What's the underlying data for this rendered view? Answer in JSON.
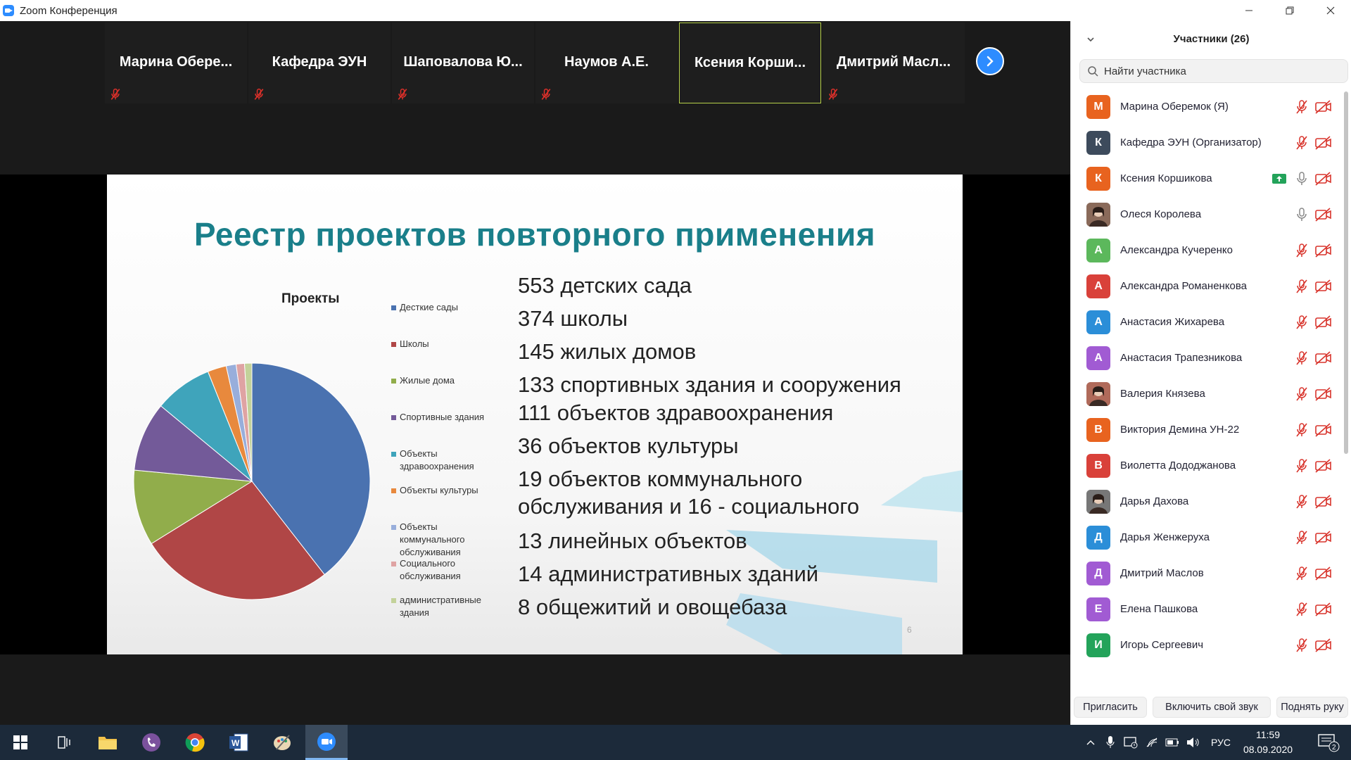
{
  "window": {
    "title": "Zoom Конференция",
    "controls": {
      "minimize": "—",
      "restore": "❐",
      "close": "✕"
    }
  },
  "gallery": {
    "tiles": [
      {
        "name": "Марина  Обере...",
        "muted": true,
        "active": false
      },
      {
        "name": "Кафедра ЭУН",
        "muted": true,
        "active": false
      },
      {
        "name": "Шаповалова  Ю...",
        "muted": true,
        "active": false
      },
      {
        "name": "Наумов А.Е.",
        "muted": true,
        "active": false
      },
      {
        "name": "Ксения  Корши...",
        "muted": false,
        "active": true
      },
      {
        "name": "Дмитрий  Масл...",
        "muted": true,
        "active": false
      }
    ],
    "next_icon": "chevron-right-icon"
  },
  "slide": {
    "title": "Реестр проектов повторного применения",
    "page_number": "6",
    "stats": [
      "553 детских сада",
      "374 школы",
      "145 жилых домов",
      "133 спортивных здания и сооружения",
      "111 объектов здравоохранения",
      "36 объектов культуры",
      "19 объектов коммунального",
      "обслуживания и 16 - социального",
      "13 линейных объектов",
      "14 административных зданий",
      "8 общежитий и овощебаза"
    ],
    "chart_data": {
      "type": "pie",
      "title": "Проекты",
      "legend_position": "right",
      "categories": [
        "Десткие сады",
        "Школы",
        "Жилые дома",
        "Спортивные здания",
        "Объекты здравоохранения",
        "Объекты культуры",
        "Объекты коммунального обслуживания",
        "Социального обслуживания",
        "административные здания"
      ],
      "values": [
        553,
        374,
        145,
        133,
        111,
        36,
        19,
        16,
        14
      ],
      "colors": [
        "#4a72b0",
        "#b04646",
        "#91ad4b",
        "#735a99",
        "#3fa4bb",
        "#e8893d",
        "#98aedb",
        "#dfa3a3",
        "#c3d29a"
      ]
    }
  },
  "panel": {
    "title": "Участники (26)",
    "search_placeholder": "Найти участника",
    "participants": [
      {
        "name": "Марина Оберемок (Я)",
        "initial": "М",
        "color": "#e8631f",
        "mic": "muted",
        "sharing": false,
        "photo": false
      },
      {
        "name": "Кафедра ЭУН (Организатор)",
        "initial": "К",
        "color": "#3d4b5c",
        "mic": "muted",
        "sharing": false,
        "photo": false
      },
      {
        "name": "Ксения Коршикова",
        "initial": "К",
        "color": "#e8631f",
        "mic": "on",
        "sharing": true,
        "photo": false
      },
      {
        "name": "Олеся Королева",
        "initial": "",
        "color": "#8a6a5a",
        "mic": "on",
        "sharing": false,
        "photo": true
      },
      {
        "name": "Александра Кучеренко",
        "initial": "А",
        "color": "#5cb85c",
        "mic": "muted",
        "sharing": false,
        "photo": false
      },
      {
        "name": "Александра Романенкова",
        "initial": "А",
        "color": "#d9413a",
        "mic": "muted",
        "sharing": false,
        "photo": false
      },
      {
        "name": "Анастасия Жихарева",
        "initial": "А",
        "color": "#2b8ed8",
        "mic": "muted",
        "sharing": false,
        "photo": false
      },
      {
        "name": "Анастасия Трапезникова",
        "initial": "А",
        "color": "#a15bd3",
        "mic": "muted",
        "sharing": false,
        "photo": false
      },
      {
        "name": "Валерия Князева",
        "initial": "",
        "color": "#b06a5a",
        "mic": "muted",
        "sharing": false,
        "photo": true
      },
      {
        "name": "Виктория Демина УН-22",
        "initial": "В",
        "color": "#e8631f",
        "mic": "muted",
        "sharing": false,
        "photo": false
      },
      {
        "name": "Виолетта Дододжанова",
        "initial": "В",
        "color": "#d9413a",
        "mic": "muted",
        "sharing": false,
        "photo": false
      },
      {
        "name": "Дарья Дахова",
        "initial": "",
        "color": "#777",
        "mic": "muted",
        "sharing": false,
        "photo": true
      },
      {
        "name": "Дарья Женжеруха",
        "initial": "Д",
        "color": "#2b8ed8",
        "mic": "muted",
        "sharing": false,
        "photo": false
      },
      {
        "name": "Дмитрий Маслов",
        "initial": "Д",
        "color": "#a15bd3",
        "mic": "muted",
        "sharing": false,
        "photo": false
      },
      {
        "name": "Елена Пашкова",
        "initial": "Е",
        "color": "#a15bd3",
        "mic": "muted",
        "sharing": false,
        "photo": false
      },
      {
        "name": "Игорь Сергеевич",
        "initial": "И",
        "color": "#23a35a",
        "mic": "muted",
        "sharing": false,
        "photo": false
      }
    ],
    "buttons": {
      "invite": "Пригласить",
      "unmute": "Включить свой звук",
      "raise_hand": "Поднять руку"
    }
  },
  "taskbar": {
    "apps": [
      "start-icon",
      "task-view-icon",
      "file-explorer-icon",
      "viber-icon",
      "chrome-icon",
      "word-icon",
      "paint-icon",
      "zoom-icon"
    ],
    "language": "РУС",
    "time": "11:59",
    "date": "08.09.2020",
    "notifications": "2"
  }
}
